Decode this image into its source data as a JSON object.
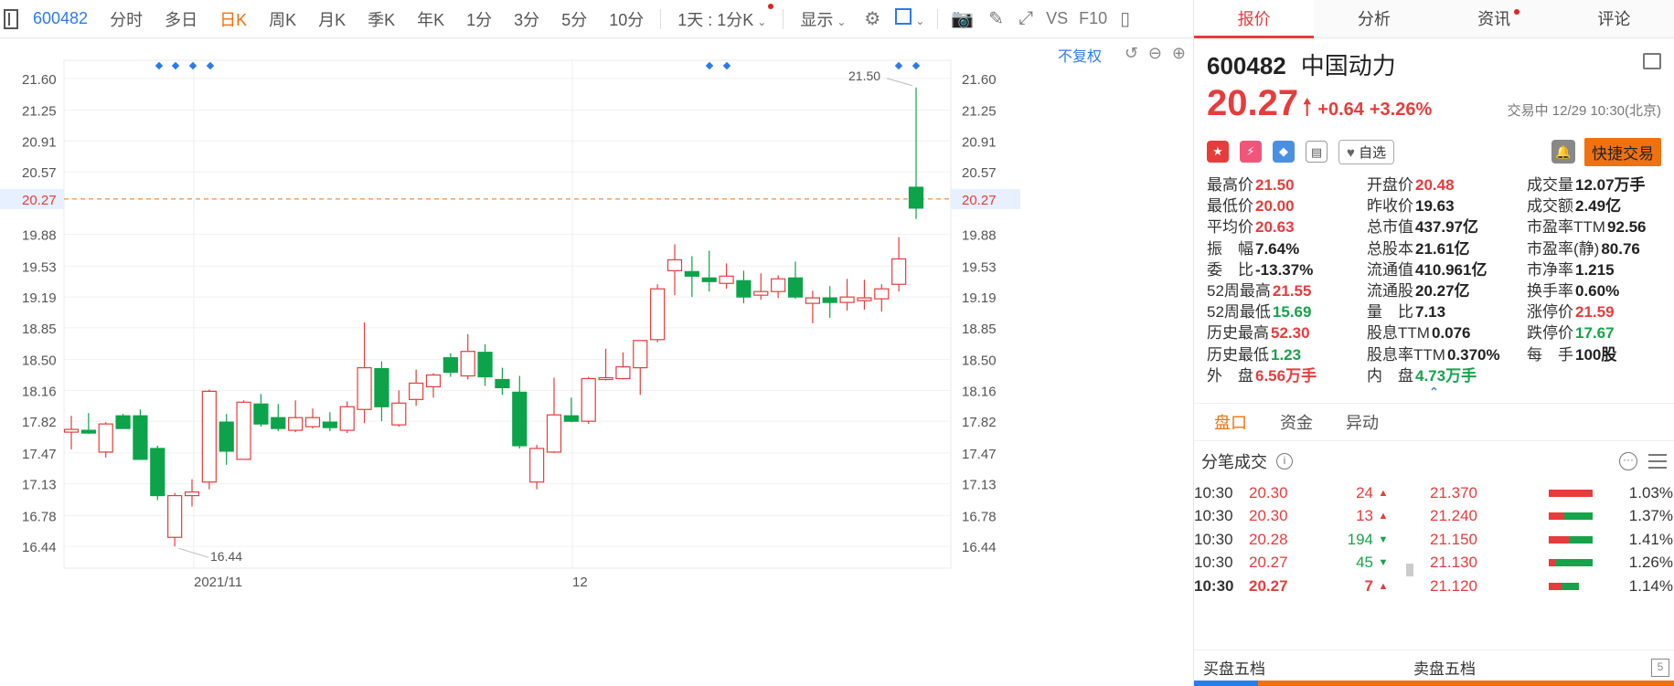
{
  "toolbar": {
    "stock_code": "600482",
    "periods": [
      "分时",
      "多日",
      "日K",
      "周K",
      "月K",
      "季K",
      "年K",
      "1分",
      "3分",
      "5分",
      "10分"
    ],
    "active_period": "日K",
    "interval_select": "1天 : 1分K",
    "display_label": "显示",
    "vs_label": "VS",
    "f10_label": "F10"
  },
  "chart": {
    "adjust_label": "不复权",
    "price_levels": [
      "21.60",
      "21.25",
      "20.91",
      "20.57",
      "20.27",
      "19.88",
      "19.53",
      "19.19",
      "18.85",
      "18.50",
      "18.16",
      "17.82",
      "17.47",
      "17.13",
      "16.78",
      "16.44"
    ],
    "current_price_label": "20.27",
    "date_labels": [
      "2021/11",
      "12"
    ],
    "high_marker": "21.50",
    "low_marker": "16.44"
  },
  "chart_data": {
    "type": "candlestick",
    "ylim": [
      16.2,
      21.8
    ],
    "current_price": 20.27,
    "candles": [
      {
        "o": 17.7,
        "h": 17.88,
        "l": 17.51,
        "c": 17.73
      },
      {
        "o": 17.72,
        "h": 17.91,
        "l": 17.68,
        "c": 17.69
      },
      {
        "o": 17.48,
        "h": 17.81,
        "l": 17.42,
        "c": 17.79
      },
      {
        "o": 17.88,
        "h": 17.9,
        "l": 17.74,
        "c": 17.74
      },
      {
        "o": 17.88,
        "h": 17.95,
        "l": 17.4,
        "c": 17.4
      },
      {
        "o": 17.52,
        "h": 17.55,
        "l": 16.95,
        "c": 17.0
      },
      {
        "o": 16.54,
        "h": 17.03,
        "l": 16.44,
        "c": 17.0
      },
      {
        "o": 17.0,
        "h": 17.18,
        "l": 16.88,
        "c": 17.04
      },
      {
        "o": 17.15,
        "h": 18.17,
        "l": 17.07,
        "c": 18.15
      },
      {
        "o": 17.81,
        "h": 17.9,
        "l": 17.34,
        "c": 17.49
      },
      {
        "o": 17.4,
        "h": 18.05,
        "l": 17.4,
        "c": 18.03
      },
      {
        "o": 18.01,
        "h": 18.12,
        "l": 17.76,
        "c": 17.79
      },
      {
        "o": 17.86,
        "h": 18.01,
        "l": 17.71,
        "c": 17.74
      },
      {
        "o": 17.72,
        "h": 18.05,
        "l": 17.7,
        "c": 17.86
      },
      {
        "o": 17.76,
        "h": 17.96,
        "l": 17.74,
        "c": 17.86
      },
      {
        "o": 17.81,
        "h": 17.92,
        "l": 17.71,
        "c": 17.75
      },
      {
        "o": 17.72,
        "h": 18.04,
        "l": 17.69,
        "c": 17.98
      },
      {
        "o": 17.95,
        "h": 18.91,
        "l": 17.8,
        "c": 18.41
      },
      {
        "o": 18.4,
        "h": 18.48,
        "l": 17.82,
        "c": 17.98
      },
      {
        "o": 17.78,
        "h": 18.16,
        "l": 17.76,
        "c": 18.02
      },
      {
        "o": 18.06,
        "h": 18.39,
        "l": 17.99,
        "c": 18.24
      },
      {
        "o": 18.2,
        "h": 18.35,
        "l": 18.08,
        "c": 18.33
      },
      {
        "o": 18.52,
        "h": 18.57,
        "l": 18.31,
        "c": 18.36
      },
      {
        "o": 18.32,
        "h": 18.78,
        "l": 18.28,
        "c": 18.59
      },
      {
        "o": 18.58,
        "h": 18.67,
        "l": 18.21,
        "c": 18.31
      },
      {
        "o": 18.28,
        "h": 18.41,
        "l": 18.11,
        "c": 18.19
      },
      {
        "o": 18.14,
        "h": 18.32,
        "l": 17.52,
        "c": 17.55
      },
      {
        "o": 17.15,
        "h": 17.56,
        "l": 17.07,
        "c": 17.52
      },
      {
        "o": 17.48,
        "h": 18.3,
        "l": 17.47,
        "c": 17.89
      },
      {
        "o": 17.88,
        "h": 18.08,
        "l": 17.81,
        "c": 17.82
      },
      {
        "o": 17.82,
        "h": 18.31,
        "l": 17.79,
        "c": 18.29
      },
      {
        "o": 18.28,
        "h": 18.62,
        "l": 18.27,
        "c": 18.3
      },
      {
        "o": 18.29,
        "h": 18.58,
        "l": 18.28,
        "c": 18.42
      },
      {
        "o": 18.41,
        "h": 18.71,
        "l": 18.11,
        "c": 18.71
      },
      {
        "o": 18.72,
        "h": 19.33,
        "l": 18.69,
        "c": 19.28
      },
      {
        "o": 19.48,
        "h": 19.77,
        "l": 19.21,
        "c": 19.6
      },
      {
        "o": 19.47,
        "h": 19.64,
        "l": 19.19,
        "c": 19.42
      },
      {
        "o": 19.4,
        "h": 19.7,
        "l": 19.25,
        "c": 19.36
      },
      {
        "o": 19.34,
        "h": 19.56,
        "l": 19.28,
        "c": 19.42
      },
      {
        "o": 19.37,
        "h": 19.48,
        "l": 19.12,
        "c": 19.19
      },
      {
        "o": 19.21,
        "h": 19.45,
        "l": 19.16,
        "c": 19.25
      },
      {
        "o": 19.25,
        "h": 19.43,
        "l": 19.18,
        "c": 19.39
      },
      {
        "o": 19.4,
        "h": 19.58,
        "l": 19.17,
        "c": 19.19
      },
      {
        "o": 19.12,
        "h": 19.26,
        "l": 18.9,
        "c": 19.18
      },
      {
        "o": 19.18,
        "h": 19.31,
        "l": 18.96,
        "c": 19.13
      },
      {
        "o": 19.13,
        "h": 19.39,
        "l": 19.04,
        "c": 19.19
      },
      {
        "o": 19.15,
        "h": 19.38,
        "l": 19.05,
        "c": 19.18
      },
      {
        "o": 19.17,
        "h": 19.33,
        "l": 19.03,
        "c": 19.28
      },
      {
        "o": 19.33,
        "h": 19.85,
        "l": 19.25,
        "c": 19.61
      },
      {
        "o": 20.4,
        "h": 21.5,
        "l": 20.05,
        "c": 20.17
      }
    ]
  },
  "panel": {
    "tabs": [
      "报价",
      "分析",
      "资讯",
      "评论"
    ],
    "code": "600482",
    "name": "中国动力",
    "price": "20.27",
    "change": "+0.64",
    "change_pct": "+3.26%",
    "status_time": "交易中 12/29 10:30(北京)",
    "zixuan": "自选",
    "quick_trade": "快捷交易",
    "stats": [
      {
        "label": "最高价",
        "value": "21.50",
        "color": "red"
      },
      {
        "label": "开盘价",
        "value": "20.48",
        "color": "red"
      },
      {
        "label": "成交量",
        "value": "12.07万手",
        "color": "dark"
      },
      {
        "label": "最低价",
        "value": "20.00",
        "color": "red"
      },
      {
        "label": "昨收价",
        "value": "19.63",
        "color": "dark"
      },
      {
        "label": "成交额",
        "value": "2.49亿",
        "color": "dark"
      },
      {
        "label": "平均价",
        "value": "20.63",
        "color": "red"
      },
      {
        "label": "总市值",
        "value": "437.97亿",
        "color": "dark"
      },
      {
        "label": "市盈率TTM",
        "value": "92.56",
        "color": "dark"
      },
      {
        "label": "振　幅",
        "value": "7.64%",
        "color": "dark"
      },
      {
        "label": "总股本",
        "value": "21.61亿",
        "color": "dark"
      },
      {
        "label": "市盈率(静)",
        "value": "80.76",
        "color": "dark"
      },
      {
        "label": "委　比",
        "value": "-13.37%",
        "color": "dark"
      },
      {
        "label": "流通值",
        "value": "410.961亿",
        "color": "dark"
      },
      {
        "label": "市净率",
        "value": "1.215",
        "color": "dark"
      },
      {
        "label": "52周最高",
        "value": "21.55",
        "color": "red"
      },
      {
        "label": "流通股",
        "value": "20.27亿",
        "color": "dark"
      },
      {
        "label": "换手率",
        "value": "0.60%",
        "color": "dark"
      },
      {
        "label": "52周最低",
        "value": "15.69",
        "color": "green"
      },
      {
        "label": "量　比",
        "value": "7.13",
        "color": "dark"
      },
      {
        "label": "涨停价",
        "value": "21.59",
        "color": "red"
      },
      {
        "label": "历史最高",
        "value": "52.30",
        "color": "red"
      },
      {
        "label": "股息TTM",
        "value": "0.076",
        "color": "dark"
      },
      {
        "label": "跌停价",
        "value": "17.67",
        "color": "green"
      },
      {
        "label": "历史最低",
        "value": "1.23",
        "color": "green"
      },
      {
        "label": "股息率TTM",
        "value": "0.370%",
        "color": "dark"
      },
      {
        "label": "每　手",
        "value": "100股",
        "color": "dark"
      },
      {
        "label": "外　盘",
        "value": "6.56万手",
        "color": "red"
      },
      {
        "label": "内　盘",
        "value": "4.73万手",
        "color": "green"
      }
    ],
    "subtabs": [
      "盘口",
      "资金",
      "异动"
    ],
    "ticks_title": "分笔成交",
    "ticks": [
      {
        "time": "10:30",
        "price": "20.30",
        "vol": "24",
        "dir": "up"
      },
      {
        "time": "10:30",
        "price": "20.30",
        "vol": "13",
        "dir": "up"
      },
      {
        "time": "10:30",
        "price": "20.28",
        "vol": "194",
        "dir": "down"
      },
      {
        "time": "10:30",
        "price": "20.27",
        "vol": "45",
        "dir": "down"
      },
      {
        "time": "10:30",
        "price": "20.27",
        "vol": "7",
        "dir": "up"
      }
    ],
    "dist": [
      {
        "price": "21.370",
        "ratio": "1.03%",
        "buy": 1.0,
        "sell": 0.0
      },
      {
        "price": "21.240",
        "ratio": "1.37%",
        "buy": 0.35,
        "sell": 0.65
      },
      {
        "price": "21.150",
        "ratio": "1.41%",
        "buy": 0.45,
        "sell": 0.55
      },
      {
        "price": "21.130",
        "ratio": "1.26%",
        "buy": 0.15,
        "sell": 0.85
      },
      {
        "price": "21.120",
        "ratio": "1.14%",
        "buy": 0.3,
        "sell": 0.4
      }
    ],
    "buy_five": "买盘五档",
    "sell_five": "卖盘五档"
  }
}
